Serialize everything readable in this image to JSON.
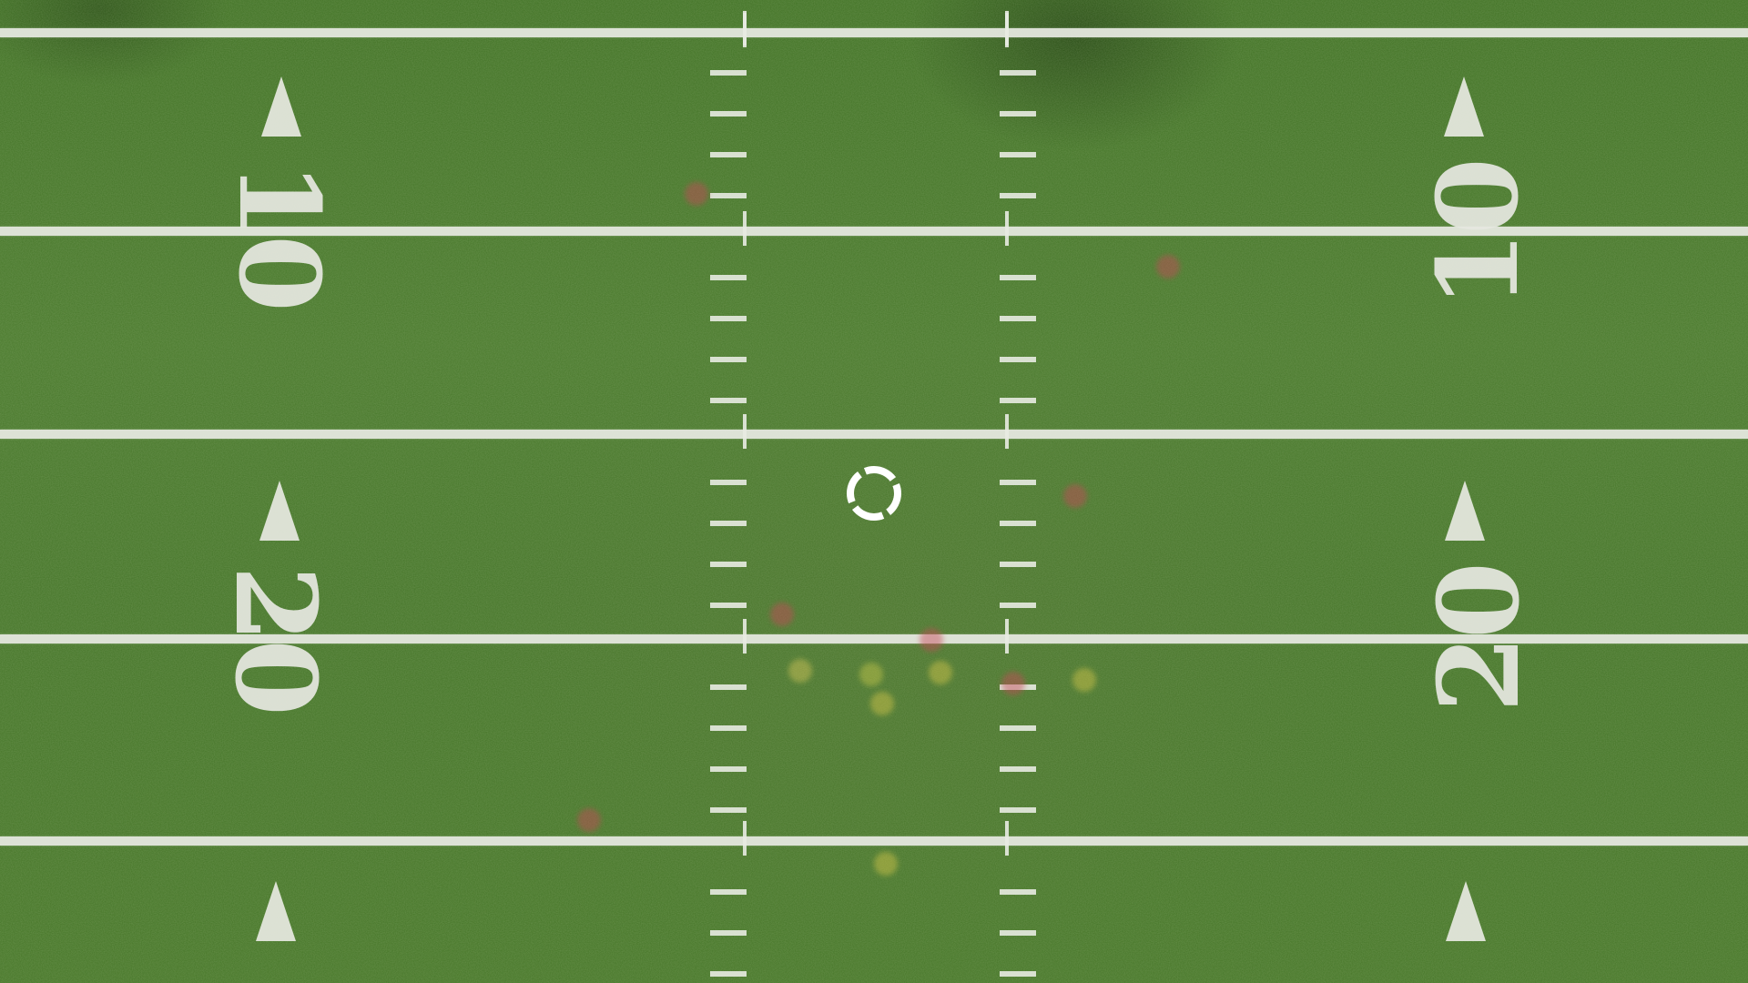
{
  "field": {
    "yard_numbers": [
      {
        "id": "left-10",
        "text": "10",
        "side": "left"
      },
      {
        "id": "left-20",
        "text": "20",
        "side": "left"
      },
      {
        "id": "right-10",
        "text": "10",
        "side": "right"
      },
      {
        "id": "right-20",
        "text": "20",
        "side": "right"
      }
    ],
    "colors": {
      "turf": "#4c7a2e",
      "paint": "#e9ebe4"
    }
  },
  "overlay": {
    "icon": "loading-spinner-icon"
  }
}
